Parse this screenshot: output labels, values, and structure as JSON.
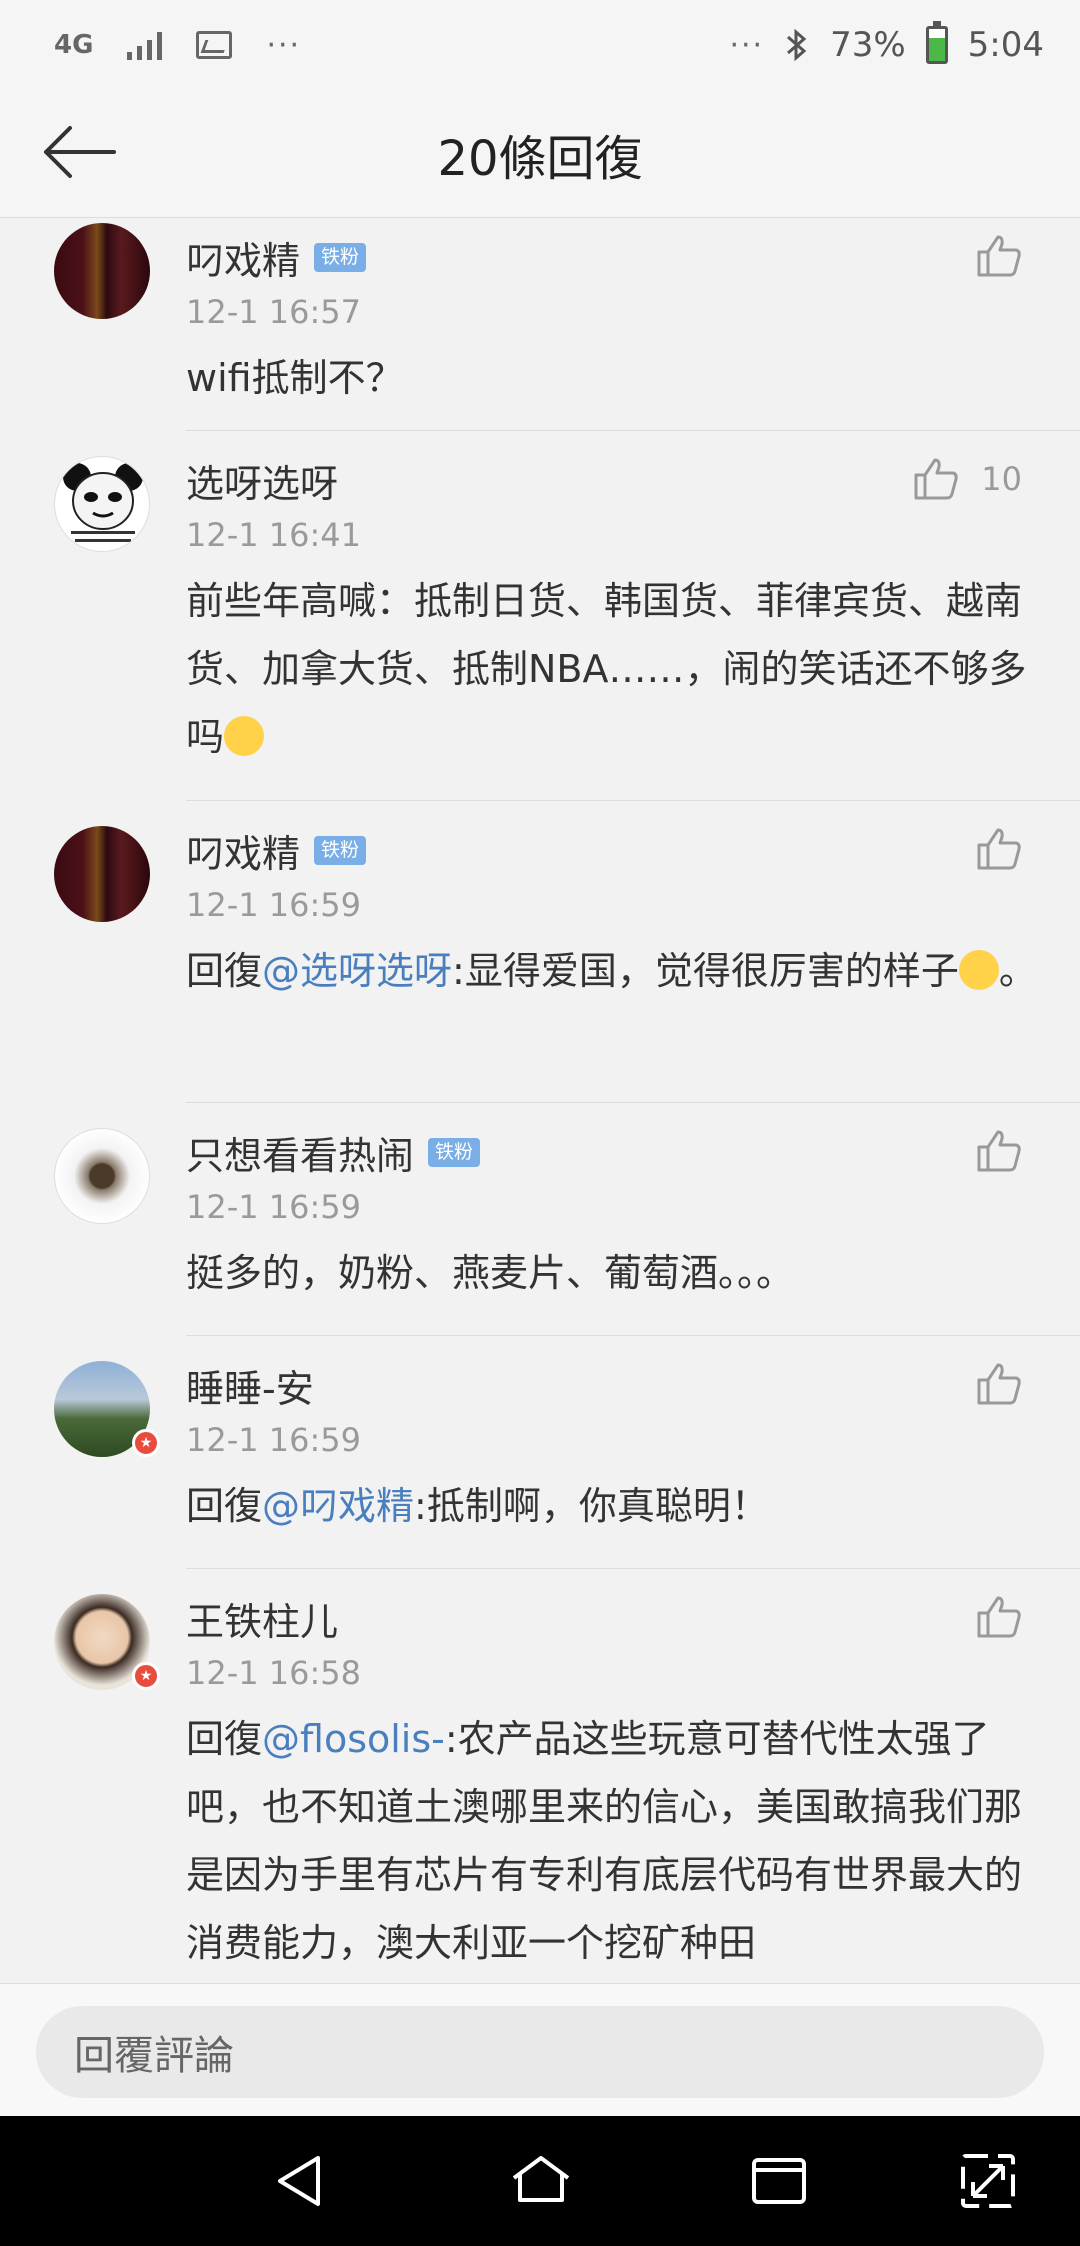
{
  "status_bar": {
    "network": "4G",
    "dots_left": "···",
    "dots_right": "···",
    "battery": "73%",
    "time": "5:04"
  },
  "header": {
    "title": "20條回復"
  },
  "comments": [
    {
      "user": "叼戏精",
      "badge": "铁粉",
      "time": "12-1 16:57",
      "text": "wifi抵制不？",
      "likes": ""
    },
    {
      "user": "选呀选呀",
      "badge": "",
      "time": "12-1 16:41",
      "text": "前些年高喊：抵制日货、韩国货、菲律宾货、越南货、加拿大货、抵制NBA……，闹的笑话还不够多吗",
      "likes": "10"
    },
    {
      "user": "叼戏精",
      "badge": "铁粉",
      "time": "12-1 16:59",
      "prefix": "回復",
      "mention": "@选呀选呀",
      "text": ":显得爱国，觉得很厉害的样子",
      "suffix": "。",
      "likes": ""
    },
    {
      "user": "只想看看热闹",
      "badge": "铁粉",
      "time": "12-1 16:59",
      "text": "挺多的，奶粉、燕麦片、葡萄酒。。。",
      "likes": ""
    },
    {
      "user": "睡睡-安",
      "badge": "",
      "time": "12-1 16:59",
      "prefix": "回復",
      "mention": "@叼戏精",
      "text": ":抵制啊，你真聪明！",
      "likes": ""
    },
    {
      "user": "王铁柱儿",
      "badge": "",
      "time": "12-1 16:58",
      "prefix": "回復",
      "mention": "@flosolis-",
      "text": ":农产品这些玩意可替代性太强了吧，也不知道土澳哪里来的信心，美国敢搞我们那是因为手里有芯片有专利有底层代码有世界最大的消费能力，澳大利亚一个挖矿种田",
      "likes": ""
    }
  ],
  "reply_input": {
    "placeholder": "回覆評論"
  },
  "colors": {
    "mention": "#4a7fbf",
    "badge": "#7aaee6",
    "background": "#f2f2f2"
  }
}
